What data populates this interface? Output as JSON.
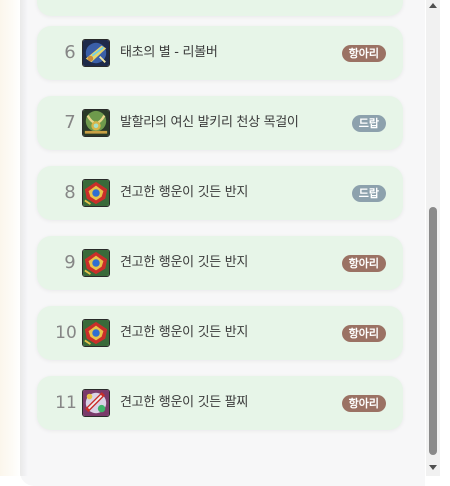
{
  "list": {
    "items": [
      {
        "rank": "",
        "name": "",
        "badge": "",
        "badge_color": "",
        "icon": "none"
      },
      {
        "rank": "6",
        "name": "태초의 별 - 리볼버",
        "badge": "항아리",
        "badge_color": "#9b7264",
        "icon": "revolver-icon"
      },
      {
        "rank": "7",
        "name": "발할라의 여신 발키리 천상 목걸이",
        "badge": "드랍",
        "badge_color": "#8da1ad",
        "icon": "necklace-icon"
      },
      {
        "rank": "8",
        "name": "견고한 행운이 깃든 반지",
        "badge": "드랍",
        "badge_color": "#8da1ad",
        "icon": "ring-icon"
      },
      {
        "rank": "9",
        "name": "견고한 행운이 깃든 반지",
        "badge": "항아리",
        "badge_color": "#9b7264",
        "icon": "ring-icon"
      },
      {
        "rank": "10",
        "name": "견고한 행운이 깃든 반지",
        "badge": "항아리",
        "badge_color": "#9b7264",
        "icon": "ring-icon"
      },
      {
        "rank": "11",
        "name": "견고한 행운이 깃든 팔찌",
        "badge": "항아리",
        "badge_color": "#9b7264",
        "icon": "bracelet-icon"
      }
    ]
  },
  "scrollbar": {
    "up_icon": "arrow-up-icon",
    "down_icon": "arrow-down-icon"
  }
}
